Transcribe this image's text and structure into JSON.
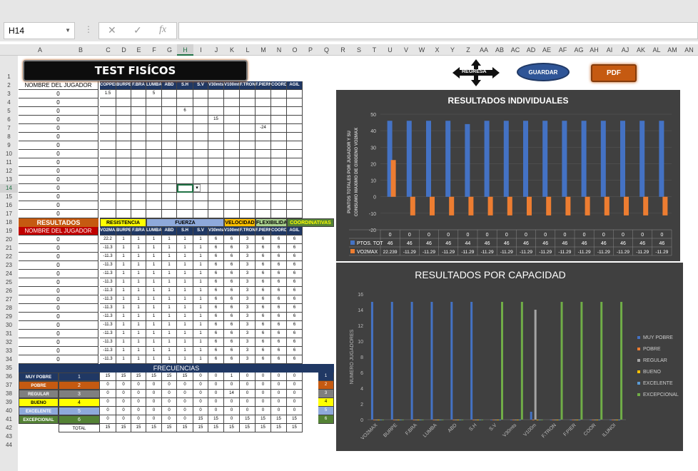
{
  "namebox": "H14",
  "formula_icons": {
    "cancel": "✕",
    "enter": "✓",
    "fx": "fx"
  },
  "columns": [
    "A",
    "B",
    "C",
    "D",
    "E",
    "F",
    "G",
    "H",
    "I",
    "J",
    "K",
    "L",
    "M",
    "N",
    "O",
    "P",
    "Q",
    "R",
    "S",
    "T",
    "U",
    "V",
    "W",
    "X",
    "Y",
    "Z",
    "AA",
    "AB",
    "AC",
    "AD",
    "AE",
    "AF",
    "AG",
    "AH",
    "AI",
    "AJ",
    "AK",
    "AL",
    "AM",
    "AN"
  ],
  "rows": [
    "1",
    "2",
    "3",
    "4",
    "5",
    "6",
    "7",
    "8",
    "9",
    "10",
    "11",
    "12",
    "13",
    "14",
    "15",
    "16",
    "17",
    "18",
    "19",
    "20",
    "21",
    "22",
    "23",
    "24",
    "25",
    "26",
    "27",
    "28",
    "29",
    "30",
    "31",
    "32",
    "33",
    "34",
    "35",
    "36",
    "37",
    "38",
    "39",
    "40",
    "41",
    "42",
    "43",
    "44"
  ],
  "buttons": {
    "title": "TEST FISÍCOS",
    "regresa": "REGRESA",
    "guardar": "GUARDAR",
    "pdf": "PDF"
  },
  "input_header": {
    "name": "NOMBRE DEL JUGADOR",
    "cols": [
      "COPPER",
      "BURPE",
      "F.BRA",
      "LUMBA",
      "ABD",
      "S.H",
      "S.V",
      "V30mts",
      "V100mts",
      "F.TRON",
      "F.PIERN",
      "COORD",
      "AGIL"
    ]
  },
  "input_rows": [
    {
      "name": "0",
      "vals": [
        "1.5",
        "",
        "",
        "5",
        "",
        "",
        "",
        "",
        "",
        "",
        "",
        "",
        ""
      ]
    },
    {
      "name": "0",
      "vals": [
        "",
        "",
        "",
        "",
        "",
        "",
        "",
        "",
        "",
        "",
        "",
        "",
        ""
      ]
    },
    {
      "name": "0",
      "vals": [
        "",
        "",
        "",
        "",
        "",
        "6",
        "",
        "",
        "",
        "",
        "",
        "",
        ""
      ]
    },
    {
      "name": "0",
      "vals": [
        "",
        "",
        "",
        "",
        "",
        "",
        "",
        "15",
        "",
        "",
        "",
        "",
        ""
      ]
    },
    {
      "name": "0",
      "vals": [
        "",
        "",
        "",
        "",
        "",
        "",
        "",
        "",
        "",
        "",
        "-24",
        "",
        ""
      ]
    },
    {
      "name": "0",
      "vals": [
        "",
        "",
        "",
        "",
        "",
        "",
        "",
        "",
        "",
        "",
        "",
        "",
        ""
      ]
    },
    {
      "name": "0",
      "vals": [
        "",
        "",
        "",
        "",
        "",
        "",
        "",
        "",
        "",
        "",
        "",
        "",
        ""
      ]
    },
    {
      "name": "0",
      "vals": [
        "",
        "",
        "",
        "",
        "",
        "",
        "",
        "",
        "",
        "",
        "",
        "",
        ""
      ]
    },
    {
      "name": "0",
      "vals": [
        "",
        "",
        "",
        "",
        "",
        "",
        "",
        "",
        "",
        "",
        "",
        "",
        ""
      ]
    },
    {
      "name": "0",
      "vals": [
        "",
        "",
        "",
        "",
        "",
        "",
        "",
        "",
        "",
        "",
        "",
        "",
        ""
      ]
    },
    {
      "name": "0",
      "vals": [
        "",
        "",
        "",
        "",
        "",
        "",
        "",
        "",
        "",
        "",
        "",
        "",
        ""
      ]
    },
    {
      "name": "0",
      "vals": [
        "",
        "",
        "",
        "",
        "",
        "",
        "",
        "",
        "",
        "",
        "",
        "",
        ""
      ]
    },
    {
      "name": "0",
      "vals": [
        "",
        "",
        "",
        "",
        "",
        "",
        "",
        "",
        "",
        "",
        "",
        "",
        ""
      ]
    },
    {
      "name": "0",
      "vals": [
        "",
        "",
        "",
        "",
        "",
        "",
        "",
        "",
        "",
        "",
        "",
        "",
        ""
      ]
    },
    {
      "name": "0",
      "vals": [
        "",
        "",
        "",
        "",
        "",
        "",
        "",
        "",
        "",
        "",
        "",
        "",
        ""
      ]
    }
  ],
  "results": {
    "title": "RESULTADOS",
    "groups": [
      "RESISTENCIA",
      "FUERZA",
      "VELOCIDAD",
      "FLEXIBILIDAD",
      "COORDINATIVAS"
    ],
    "name": "NOMBRE DEL JUGADOR",
    "cols": [
      "VO2MAX",
      "BURPE",
      "F.BRA",
      "LUMBA",
      "ABD",
      "S.H",
      "S.V",
      "V30mts",
      "V100mts",
      "F.TRON",
      "F.PIERN",
      "COORD",
      "AGIL"
    ],
    "rows": [
      {
        "name": "0",
        "vals": [
          "22.2",
          "1",
          "1",
          "1",
          "1",
          "1",
          "1",
          "6",
          "6",
          "3",
          "6",
          "6",
          "6"
        ]
      },
      {
        "name": "0",
        "vals": [
          "-11.3",
          "1",
          "1",
          "1",
          "1",
          "1",
          "1",
          "6",
          "6",
          "3",
          "6",
          "6",
          "6"
        ]
      },
      {
        "name": "0",
        "vals": [
          "-11.3",
          "1",
          "1",
          "1",
          "1",
          "1",
          "1",
          "6",
          "6",
          "3",
          "6",
          "6",
          "6"
        ]
      },
      {
        "name": "0",
        "vals": [
          "-11.3",
          "1",
          "1",
          "1",
          "1",
          "1",
          "1",
          "6",
          "6",
          "3",
          "6",
          "6",
          "6"
        ]
      },
      {
        "name": "0",
        "vals": [
          "-11.3",
          "1",
          "1",
          "1",
          "1",
          "1",
          "1",
          "6",
          "6",
          "3",
          "6",
          "6",
          "6"
        ]
      },
      {
        "name": "0",
        "vals": [
          "-11.3",
          "1",
          "1",
          "1",
          "1",
          "1",
          "1",
          "6",
          "6",
          "3",
          "6",
          "6",
          "6"
        ]
      },
      {
        "name": "0",
        "vals": [
          "-11.3",
          "1",
          "1",
          "1",
          "1",
          "1",
          "1",
          "6",
          "6",
          "3",
          "6",
          "6",
          "6"
        ]
      },
      {
        "name": "0",
        "vals": [
          "-11.3",
          "1",
          "1",
          "1",
          "1",
          "1",
          "1",
          "6",
          "6",
          "3",
          "6",
          "6",
          "6"
        ]
      },
      {
        "name": "0",
        "vals": [
          "-11.3",
          "1",
          "1",
          "1",
          "1",
          "1",
          "1",
          "6",
          "6",
          "3",
          "6",
          "6",
          "6"
        ]
      },
      {
        "name": "0",
        "vals": [
          "-11.3",
          "1",
          "1",
          "1",
          "1",
          "1",
          "1",
          "6",
          "6",
          "3",
          "6",
          "6",
          "6"
        ]
      },
      {
        "name": "0",
        "vals": [
          "-11.3",
          "1",
          "1",
          "1",
          "1",
          "1",
          "1",
          "6",
          "6",
          "3",
          "6",
          "6",
          "6"
        ]
      },
      {
        "name": "0",
        "vals": [
          "-11.3",
          "1",
          "1",
          "1",
          "1",
          "1",
          "1",
          "6",
          "6",
          "3",
          "6",
          "6",
          "6"
        ]
      },
      {
        "name": "0",
        "vals": [
          "-11.3",
          "1",
          "1",
          "1",
          "1",
          "1",
          "1",
          "6",
          "6",
          "3",
          "6",
          "6",
          "6"
        ]
      },
      {
        "name": "0",
        "vals": [
          "-11.3",
          "1",
          "1",
          "1",
          "1",
          "1",
          "1",
          "6",
          "6",
          "3",
          "6",
          "6",
          "6"
        ]
      },
      {
        "name": "0",
        "vals": [
          "-11.3",
          "1",
          "1",
          "1",
          "1",
          "1",
          "1",
          "6",
          "6",
          "3",
          "6",
          "6",
          "6"
        ]
      }
    ]
  },
  "freq": {
    "title": "FRECUENCIAS",
    "rows": [
      {
        "label": "MUY POBRE",
        "code": "1",
        "color": "#203864",
        "vals": [
          "15",
          "15",
          "15",
          "15",
          "15",
          "15",
          "0",
          "0",
          "1",
          "0",
          "0",
          "0",
          "0"
        ],
        "end": "1"
      },
      {
        "label": "POBRE",
        "code": "2",
        "color": "#c55a11",
        "vals": [
          "0",
          "0",
          "0",
          "0",
          "0",
          "0",
          "0",
          "0",
          "0",
          "0",
          "0",
          "0",
          "0"
        ],
        "end": "2"
      },
      {
        "label": "REGULAR",
        "code": "3",
        "color": "#7f7f7f",
        "vals": [
          "0",
          "0",
          "0",
          "0",
          "0",
          "0",
          "0",
          "0",
          "14",
          "0",
          "0",
          "0",
          "0"
        ],
        "end": "3"
      },
      {
        "label": "BUENO",
        "code": "4",
        "color": "#ffff00",
        "vals": [
          "0",
          "0",
          "0",
          "0",
          "0",
          "0",
          "0",
          "0",
          "0",
          "0",
          "0",
          "0",
          "0"
        ],
        "end": "4"
      },
      {
        "label": "EXCELENTE",
        "code": "5",
        "color": "#8ea9db",
        "vals": [
          "0",
          "0",
          "0",
          "0",
          "0",
          "0",
          "0",
          "0",
          "0",
          "0",
          "0",
          "0",
          "0"
        ],
        "end": "5"
      },
      {
        "label": "EXCEPCIONAL",
        "code": "6",
        "color": "#548235",
        "vals": [
          "0",
          "0",
          "0",
          "0",
          "0",
          "0",
          "15",
          "15",
          "0",
          "15",
          "15",
          "15",
          "15"
        ],
        "end": "6"
      }
    ],
    "total_label": "TOTAL",
    "totals": [
      "15",
      "15",
      "15",
      "15",
      "15",
      "15",
      "15",
      "15",
      "15",
      "15",
      "15",
      "15",
      "15"
    ]
  },
  "chart_data": [
    {
      "type": "bar",
      "title": "RESULTADOS INDIVIDUALES",
      "ylabel": "PUNTOS TOTALES POR JUGADOR Y SU CONSUMO MAXIMO DE OXIGENO VO2MAX",
      "ylim": [
        -20,
        50
      ],
      "categories": [
        "0",
        "0",
        "0",
        "0",
        "0",
        "0",
        "0",
        "0",
        "0",
        "0",
        "0",
        "0",
        "0",
        "0",
        "0"
      ],
      "series": [
        {
          "name": "PTOS. TOT",
          "color": "#4472c4",
          "values": [
            46,
            46,
            46,
            46,
            44,
            46,
            46,
            46,
            46,
            46,
            46,
            46,
            46,
            46,
            46
          ]
        },
        {
          "name": "VO2MAX",
          "color": "#ed7d31",
          "values": [
            22.239,
            -11.29,
            -11.29,
            -11.29,
            -11.29,
            -11.29,
            -11.29,
            -11.29,
            -11.29,
            -11.29,
            -11.29,
            -11.29,
            -11.29,
            -11.29,
            -11.29
          ]
        }
      ],
      "table_labels": [
        "0",
        "0",
        "0",
        "0",
        "0",
        "0",
        "0",
        "0",
        "0",
        "0",
        "0",
        "0",
        "0",
        "0",
        "0"
      ],
      "table_row1": [
        "46",
        "46",
        "46",
        "46",
        "44",
        "46",
        "46",
        "46",
        "46",
        "46",
        "46",
        "46",
        "46",
        "46",
        "46"
      ],
      "table_row2": [
        "22.239",
        "-11.29",
        "-11.29",
        "-11.29",
        "-11.29",
        "-11.29",
        "-11.29",
        "-11.29",
        "-11.29",
        "-11.29",
        "-11.29",
        "-11.29",
        "-11.29",
        "-11.29",
        "-11.29"
      ],
      "yticks": [
        "50",
        "40",
        "30",
        "20",
        "10",
        "0",
        "-10",
        "-20"
      ]
    },
    {
      "type": "bar",
      "title": "RESULTADOS POR CAPACIDAD",
      "ylabel": "NUMERO JUGADORES",
      "ylim": [
        0,
        16
      ],
      "categories": [
        "VO2MAX",
        "BURPE",
        "F.BRA",
        "LUMBA",
        "ABD",
        "S.H",
        "S.V",
        "V30mts",
        "V100m",
        "F.TRON",
        "F.PIER",
        "COOR",
        "ILUNOI"
      ],
      "series": [
        {
          "name": "MUY POBRE",
          "color": "#4472c4",
          "values": [
            15,
            15,
            15,
            15,
            15,
            15,
            0,
            0,
            1,
            0,
            0,
            0,
            0
          ]
        },
        {
          "name": "POBRE",
          "color": "#ed7d31",
          "values": [
            0,
            0,
            0,
            0,
            0,
            0,
            0,
            0,
            0,
            0,
            0,
            0,
            0
          ]
        },
        {
          "name": "REGULAR",
          "color": "#a5a5a5",
          "values": [
            0,
            0,
            0,
            0,
            0,
            0,
            0,
            0,
            14,
            0,
            0,
            0,
            0
          ]
        },
        {
          "name": "BUENO",
          "color": "#ffc000",
          "values": [
            0,
            0,
            0,
            0,
            0,
            0,
            0,
            0,
            0,
            0,
            0,
            0,
            0
          ]
        },
        {
          "name": "EXCELENTE",
          "color": "#5b9bd5",
          "values": [
            0,
            0,
            0,
            0,
            0,
            0,
            0,
            0,
            0,
            0,
            0,
            0,
            0
          ]
        },
        {
          "name": "EXCEPCIONAL",
          "color": "#70ad47",
          "values": [
            0,
            0,
            0,
            0,
            0,
            0,
            15,
            15,
            0,
            15,
            15,
            15,
            15
          ]
        }
      ],
      "yticks": [
        "16",
        "14",
        "12",
        "10",
        "8",
        "6",
        "4",
        "2",
        "0"
      ]
    }
  ]
}
